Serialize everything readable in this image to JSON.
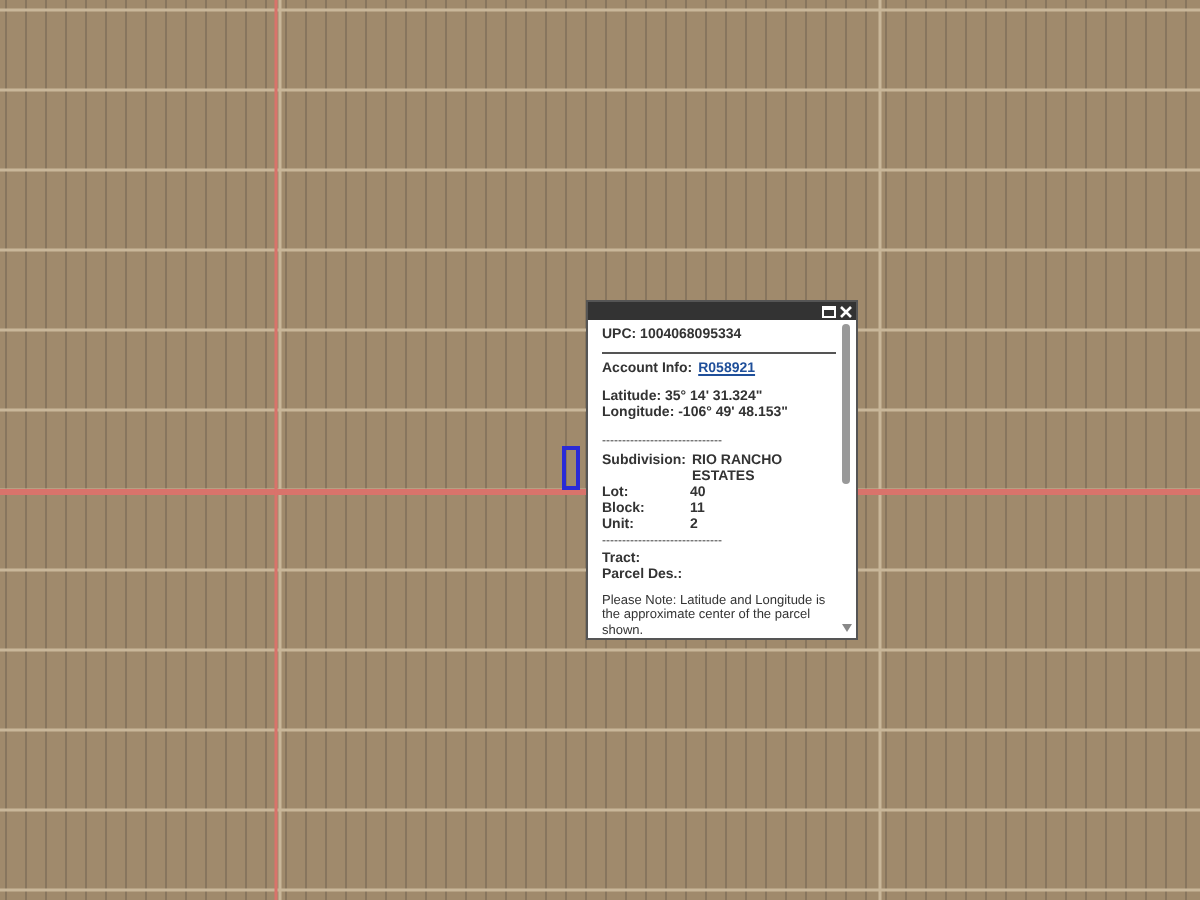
{
  "popup": {
    "upc": "UPC: 1004068095334",
    "account_label": "Account Info:",
    "account_link": "R058921",
    "latitude": "Latitude: 35° 14' 31.324\"",
    "longitude": "Longitude: -106° 49' 48.153\"",
    "separator": "------------------------------",
    "subdivision_label": "Subdivision:",
    "subdivision_value": "RIO RANCHO ESTATES",
    "fields": [
      {
        "label": "Lot:",
        "value": "40"
      },
      {
        "label": "Block:",
        "value": "11"
      },
      {
        "label": "Unit:",
        "value": "2"
      }
    ],
    "separator_2": "------------------------------",
    "tract": "Tract:",
    "parcel_des": "Parcel Des.:",
    "note": "Please Note: Latitude and Longitude is the approximate center of the parcel shown."
  }
}
